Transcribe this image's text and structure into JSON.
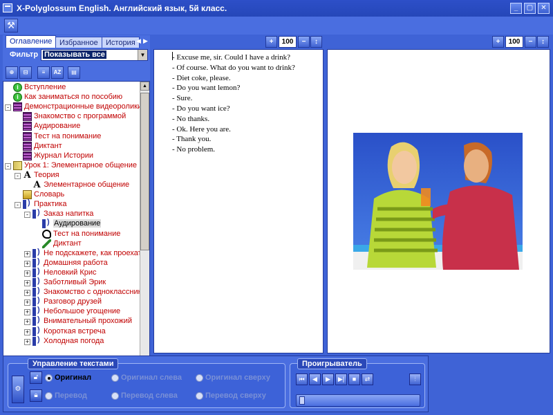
{
  "window": {
    "title": "X-Polyglossum English. Английский язык, 5й класс."
  },
  "tabs": [
    "Оглавление",
    "Избранное",
    "История"
  ],
  "filter": {
    "label": "Фильтр",
    "value": "Показывать все"
  },
  "tree": [
    {
      "label": "Вступление",
      "icon": "info-icon",
      "indent": 0,
      "expander": ""
    },
    {
      "label": "Как заниматься по пособию",
      "icon": "info-icon",
      "indent": 0,
      "expander": ""
    },
    {
      "label": "Демонстрационные видеоролики",
      "icon": "film-icon",
      "indent": 0,
      "expander": "-"
    },
    {
      "label": "Знакомство с программой",
      "icon": "film-icon",
      "indent": 1,
      "expander": ""
    },
    {
      "label": "Аудирование",
      "icon": "film-icon",
      "indent": 1,
      "expander": ""
    },
    {
      "label": "Тест на понимание",
      "icon": "film-icon",
      "indent": 1,
      "expander": ""
    },
    {
      "label": "Диктант",
      "icon": "film-icon",
      "indent": 1,
      "expander": ""
    },
    {
      "label": "Журнал Истории",
      "icon": "film-icon",
      "indent": 1,
      "expander": ""
    },
    {
      "label": "Урок 1: Элементарное общение",
      "icon": "book-icon",
      "indent": 0,
      "expander": "-"
    },
    {
      "label": "Теория",
      "icon": "letter-a-icon",
      "indent": 1,
      "expander": "-"
    },
    {
      "label": "Элементарное общение",
      "icon": "letter-a-icon",
      "indent": 2,
      "expander": ""
    },
    {
      "label": "Словарь",
      "icon": "dictionary-icon",
      "indent": 1,
      "expander": ""
    },
    {
      "label": "Практика",
      "icon": "speaker-icon",
      "indent": 1,
      "expander": "-"
    },
    {
      "label": "Заказ напитка",
      "icon": "speaker-icon",
      "indent": 2,
      "expander": "-"
    },
    {
      "label": "Аудирование",
      "icon": "speaker-icon",
      "indent": 3,
      "expander": "",
      "selected": true
    },
    {
      "label": "Тест на понимание",
      "icon": "ear-icon",
      "indent": 3,
      "expander": ""
    },
    {
      "label": "Диктант",
      "icon": "pen-icon",
      "indent": 3,
      "expander": ""
    },
    {
      "label": "Не подскажете, как проехать",
      "icon": "speaker-icon",
      "indent": 2,
      "expander": "+"
    },
    {
      "label": "Домашняя работа",
      "icon": "speaker-icon",
      "indent": 2,
      "expander": "+"
    },
    {
      "label": "Неловкий Крис",
      "icon": "speaker-icon",
      "indent": 2,
      "expander": "+"
    },
    {
      "label": "Заботливый Эрик",
      "icon": "speaker-icon",
      "indent": 2,
      "expander": "+"
    },
    {
      "label": "Знакомство с одноклассниками",
      "icon": "speaker-icon",
      "indent": 2,
      "expander": "+"
    },
    {
      "label": "Разговор друзей",
      "icon": "speaker-icon",
      "indent": 2,
      "expander": "+"
    },
    {
      "label": "Небольшое угощение",
      "icon": "speaker-icon",
      "indent": 2,
      "expander": "+"
    },
    {
      "label": "Внимательный прохожий",
      "icon": "speaker-icon",
      "indent": 2,
      "expander": "+"
    },
    {
      "label": "Короткая встреча",
      "icon": "speaker-icon",
      "indent": 2,
      "expander": "+"
    },
    {
      "label": "Холодная погода",
      "icon": "speaker-icon",
      "indent": 2,
      "expander": "+"
    }
  ],
  "zoom_left": "100",
  "zoom_right": "100",
  "dialogue": [
    "- Excuse me, sir. Could I have a drink?",
    "- Of course. What do you want to drink?",
    "- Diet coke, please.",
    "- Do you want lemon?",
    "- Sure.",
    "- Do you want ice?",
    "- No thanks.",
    "- Ok. Here you are.",
    "- Thank you.",
    "- No problem."
  ],
  "text_control": {
    "title": "Управление текстами",
    "original": "Оригинал",
    "original_left": "Оригинал слева",
    "original_top": "Оригинал сверху",
    "translation": "Перевод",
    "translation_left": "Перевод слева",
    "translation_top": "Перевод сверху"
  },
  "player": {
    "title": "Проигрыватель",
    "progress": 0
  },
  "colors": {
    "accent": "#3f63d6",
    "tree_text": "#c00000"
  }
}
